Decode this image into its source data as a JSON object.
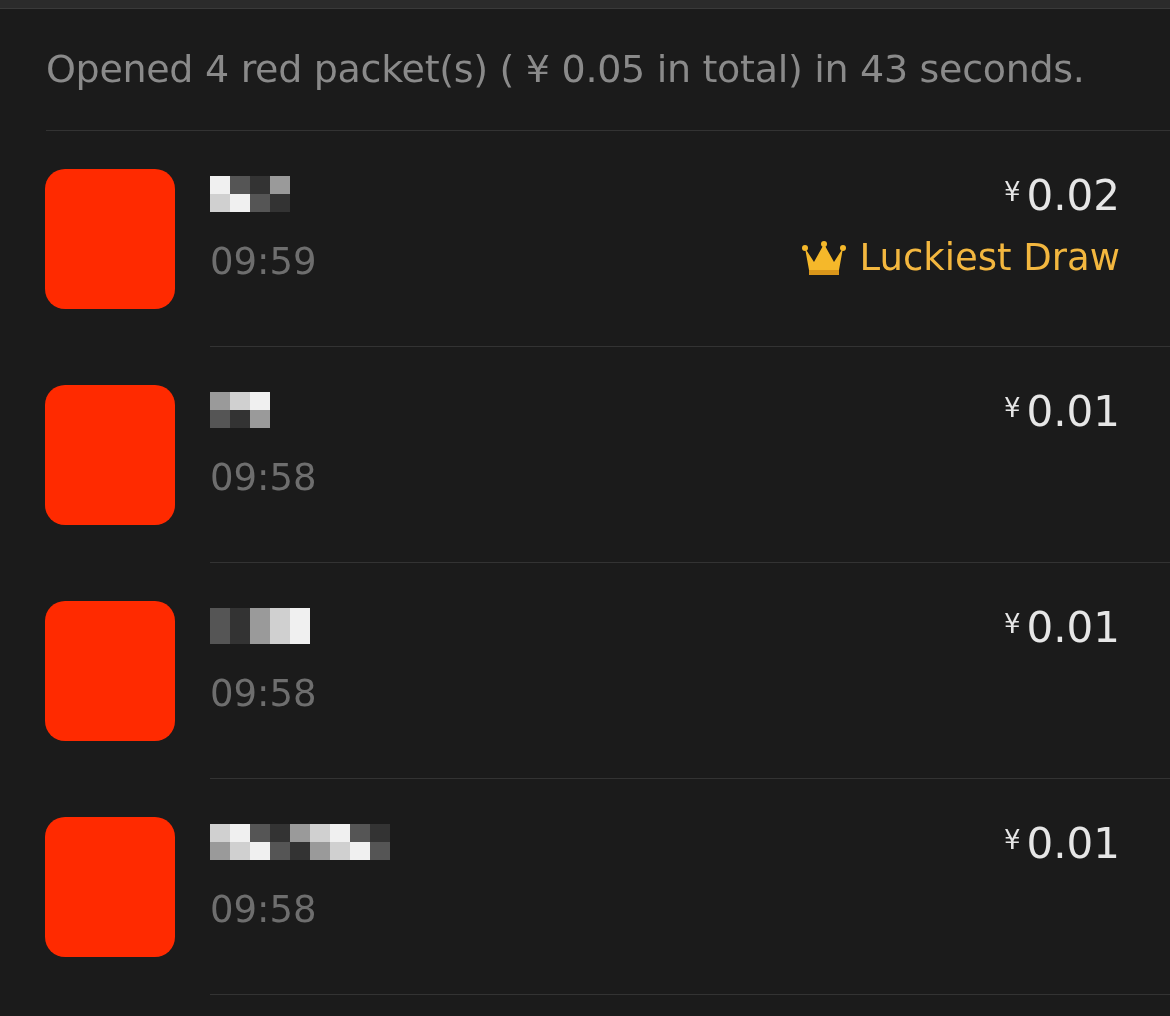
{
  "summary": "Opened 4 red packet(s) ( ¥ 0.05 in total) in 43 seconds.",
  "luckiest_label": "Luckiest Draw",
  "records": [
    {
      "time": "09:59",
      "currency": "¥",
      "amount": "0.02",
      "luckiest": true
    },
    {
      "time": "09:58",
      "currency": "¥",
      "amount": "0.01",
      "luckiest": false
    },
    {
      "time": "09:58",
      "currency": "¥",
      "amount": "0.01",
      "luckiest": false
    },
    {
      "time": "09:58",
      "currency": "¥",
      "amount": "0.01",
      "luckiest": false
    }
  ]
}
